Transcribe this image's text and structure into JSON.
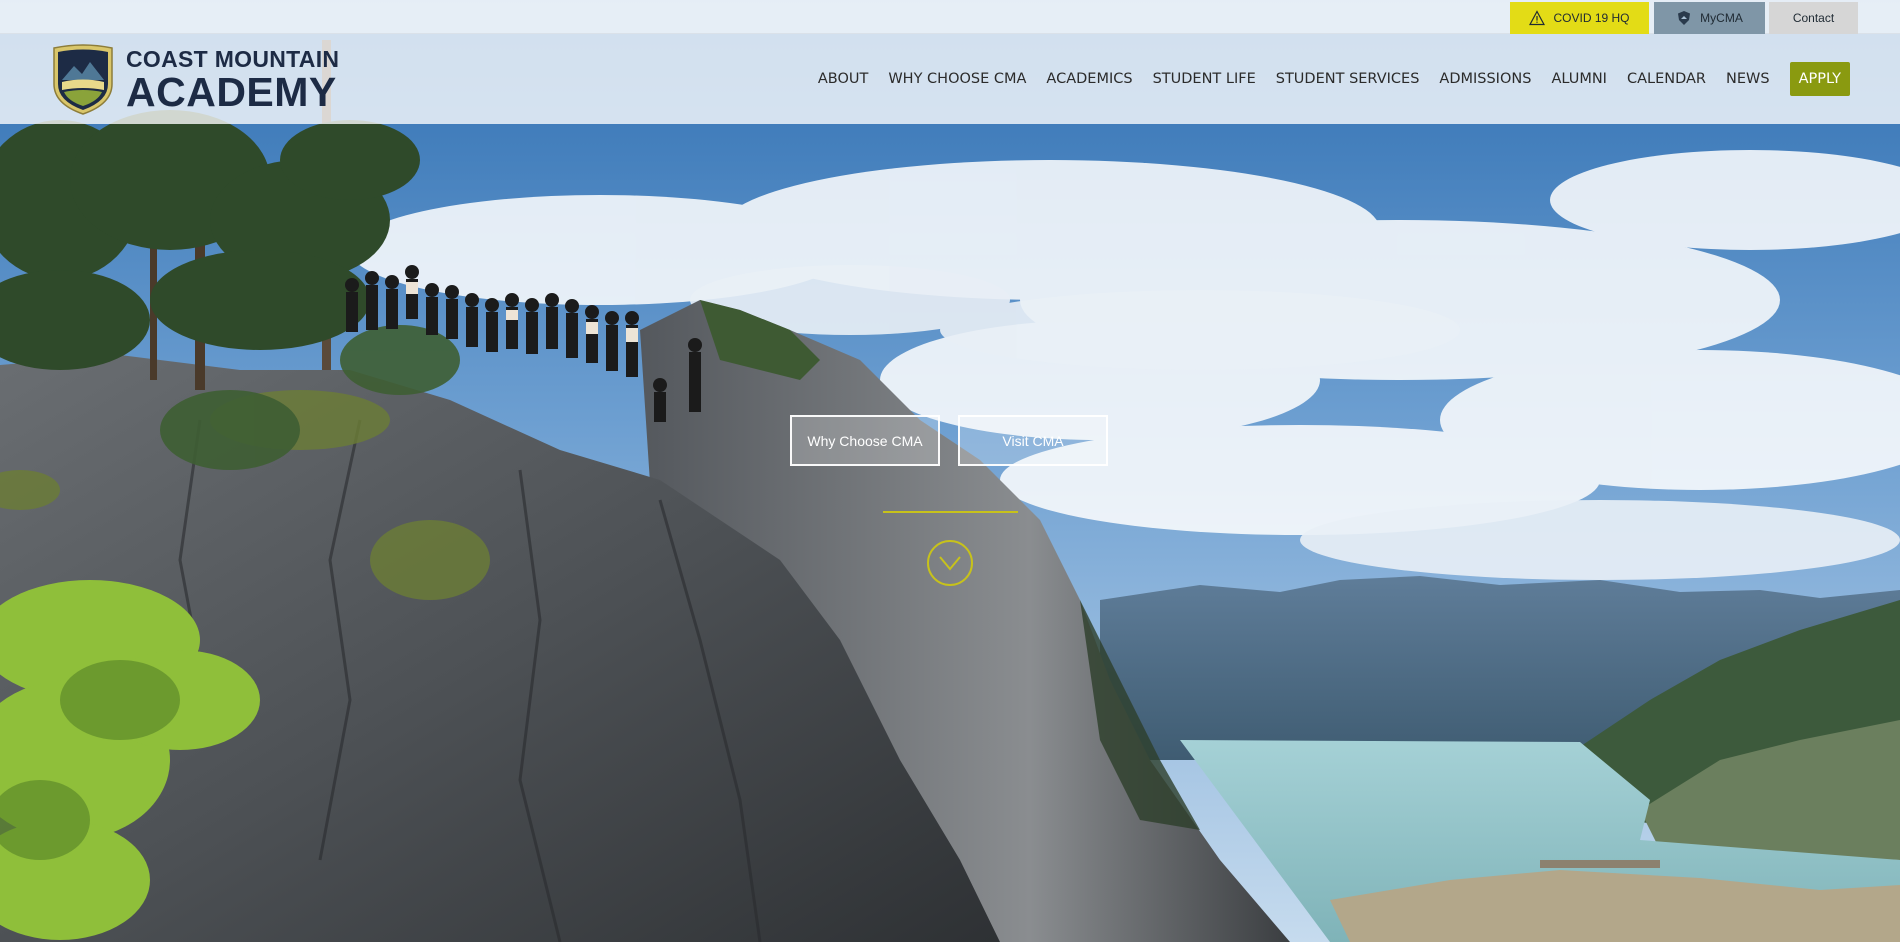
{
  "utility": {
    "covid_label": "COVID 19 HQ",
    "mycma_label": "MyCMA",
    "contact_label": "Contact"
  },
  "logo": {
    "line1": "COAST MOUNTAIN",
    "line2": "ACADEMY"
  },
  "nav": {
    "items": [
      "ABOUT",
      "WHY CHOOSE CMA",
      "ACADEMICS",
      "STUDENT LIFE",
      "STUDENT SERVICES",
      "ADMISSIONS",
      "ALUMNI",
      "CALENDAR",
      "NEWS"
    ],
    "apply_label": "APPLY"
  },
  "hero": {
    "why_label": "Why Choose CMA",
    "visit_label": "Visit CMA"
  },
  "icons": {
    "covid": "warning-icon",
    "mycma": "shield-icon",
    "scroll": "chevron-down-circle-icon",
    "crest": "mountain-crest-icon"
  },
  "colors": {
    "covid_bg": "#e3dc16",
    "mycma_bg": "#7f96a7",
    "contact_bg": "#d6d6d6",
    "apply_bg": "#8a9a10",
    "brand_navy": "#1d2b45",
    "accent_line": "#c7c21b"
  }
}
